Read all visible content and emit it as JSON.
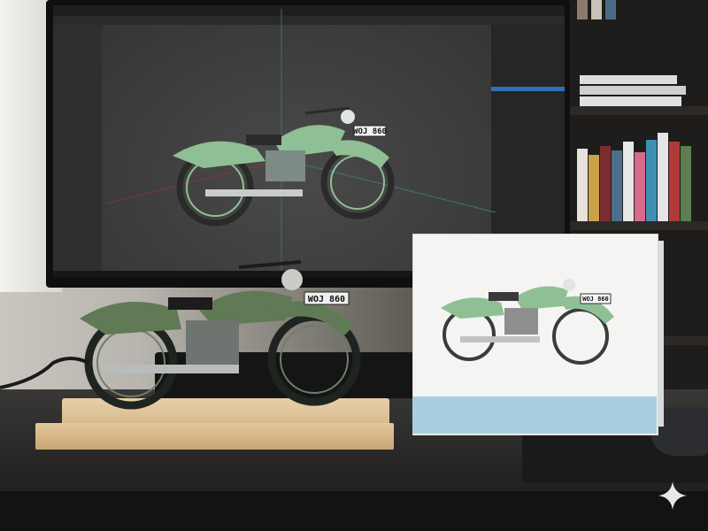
{
  "scene": {
    "monitor_bike_plate": "WOJ 860",
    "model_bike_plate": "WOJ 860",
    "box_bike_plate": "WOJ 860"
  },
  "colors": {
    "bike_green": "#8fbf95",
    "model_green": "#5f7a55",
    "viewport_gray": "#3c3c3c",
    "box_blue": "#a8cfe0",
    "wood": "#dcc095"
  },
  "icons": {
    "sparkle": "sparkle-icon"
  }
}
